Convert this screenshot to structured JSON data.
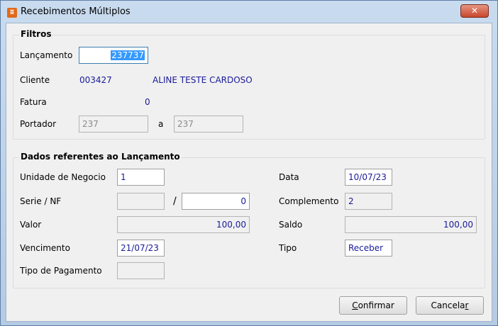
{
  "window": {
    "title": "Recebimentos Múltiplos",
    "close_glyph": "✕",
    "icon_glyph": "ʬ"
  },
  "filtros": {
    "group_title": "Filtros",
    "lancamento_label": "Lançamento",
    "lancamento_value": "237737",
    "cliente_label": "Cliente",
    "cliente_codigo": "003427",
    "cliente_nome": "ALINE TESTE CARDOSO",
    "fatura_label": "Fatura",
    "fatura_value": "0",
    "portador_label": "Portador",
    "portador_de": "237",
    "portador_sep": "a",
    "portador_ate": "237"
  },
  "dados": {
    "group_title": "Dados referentes ao Lançamento",
    "unidade_label": "Unidade de Negocio",
    "unidade_value": "1",
    "serie_label": "Serie / NF",
    "serie_value": "",
    "serie_sep": "/",
    "nf_value": "0",
    "valor_label": "Valor",
    "valor_value": "100,00",
    "vencimento_label": "Vencimento",
    "vencimento_value": "21/07/23",
    "tipo_pagamento_label": "Tipo de Pagamento",
    "tipo_pagamento_value": "",
    "data_label": "Data",
    "data_value": "10/07/23",
    "complemento_label": "Complemento",
    "complemento_value": "2",
    "saldo_label": "Saldo",
    "saldo_value": "100,00",
    "tipo_label": "Tipo",
    "tipo_value": "Receber"
  },
  "buttons": {
    "confirmar_first": "C",
    "confirmar_rest": "onfirmar",
    "cancelar_main": "Cancela",
    "cancelar_last": "r"
  }
}
